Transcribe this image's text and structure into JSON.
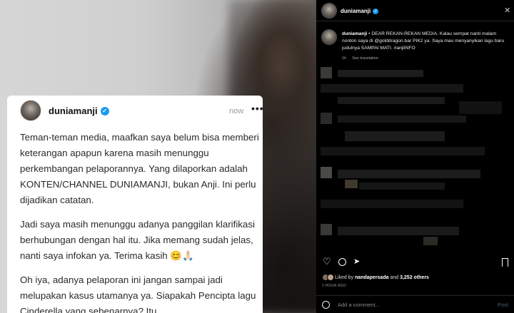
{
  "card": {
    "username": "duniamanji",
    "time": "now",
    "more_label": "•••",
    "paragraphs": [
      "Teman-teman media, maafkan saya belum bisa memberi keterangan apapun karena masih menunggu perkembangan pelaporannya. Yang dilaporkan adalah KONTEN/CHANNEL DUNIAMANJI, bukan Anji. Ini perlu dijadikan catatan.",
      "Jadi saya masih menunggu adanya panggilan klarifikasi berhubungan dengan hal itu. Jika memang sudah jelas, nanti saya infokan ya. Terima kasih 😊🙏🏻",
      "Oh iya, adanya pelaporan ini jangan sampai jadi melupakan kasus utamanya ya. Siapakah Pencipta lagu Cinderella yang sebenarnya? Itu."
    ]
  },
  "instagram": {
    "header_username": "duniamanji",
    "close_label": "✕",
    "caption_username": "duniamanji",
    "caption_text": "• DEAR REKAN-REKAN MEDIA. Kalau sempat nanti malam nonton saya di @golddragon.bar PIK2 ya. Saya mau menyanyikan lagu baru judulnya SAMPAI MATI. #anjiINFO",
    "caption_time": "1h",
    "see_translation": "See translation",
    "liked_by_prefix": "Liked by ",
    "liked_by_user": "nandapersada",
    "liked_by_and": " and ",
    "liked_by_count": "3,252 others",
    "posted_ago": "1 HOUR AGO",
    "comment_placeholder": "Add a comment...",
    "post_label": "Post"
  },
  "colors": {
    "card_bg": "#ffffff",
    "panel_bg": "#000000",
    "verified_blue": "#1d9bf0",
    "post_button_disabled": "#4a5f7a"
  }
}
